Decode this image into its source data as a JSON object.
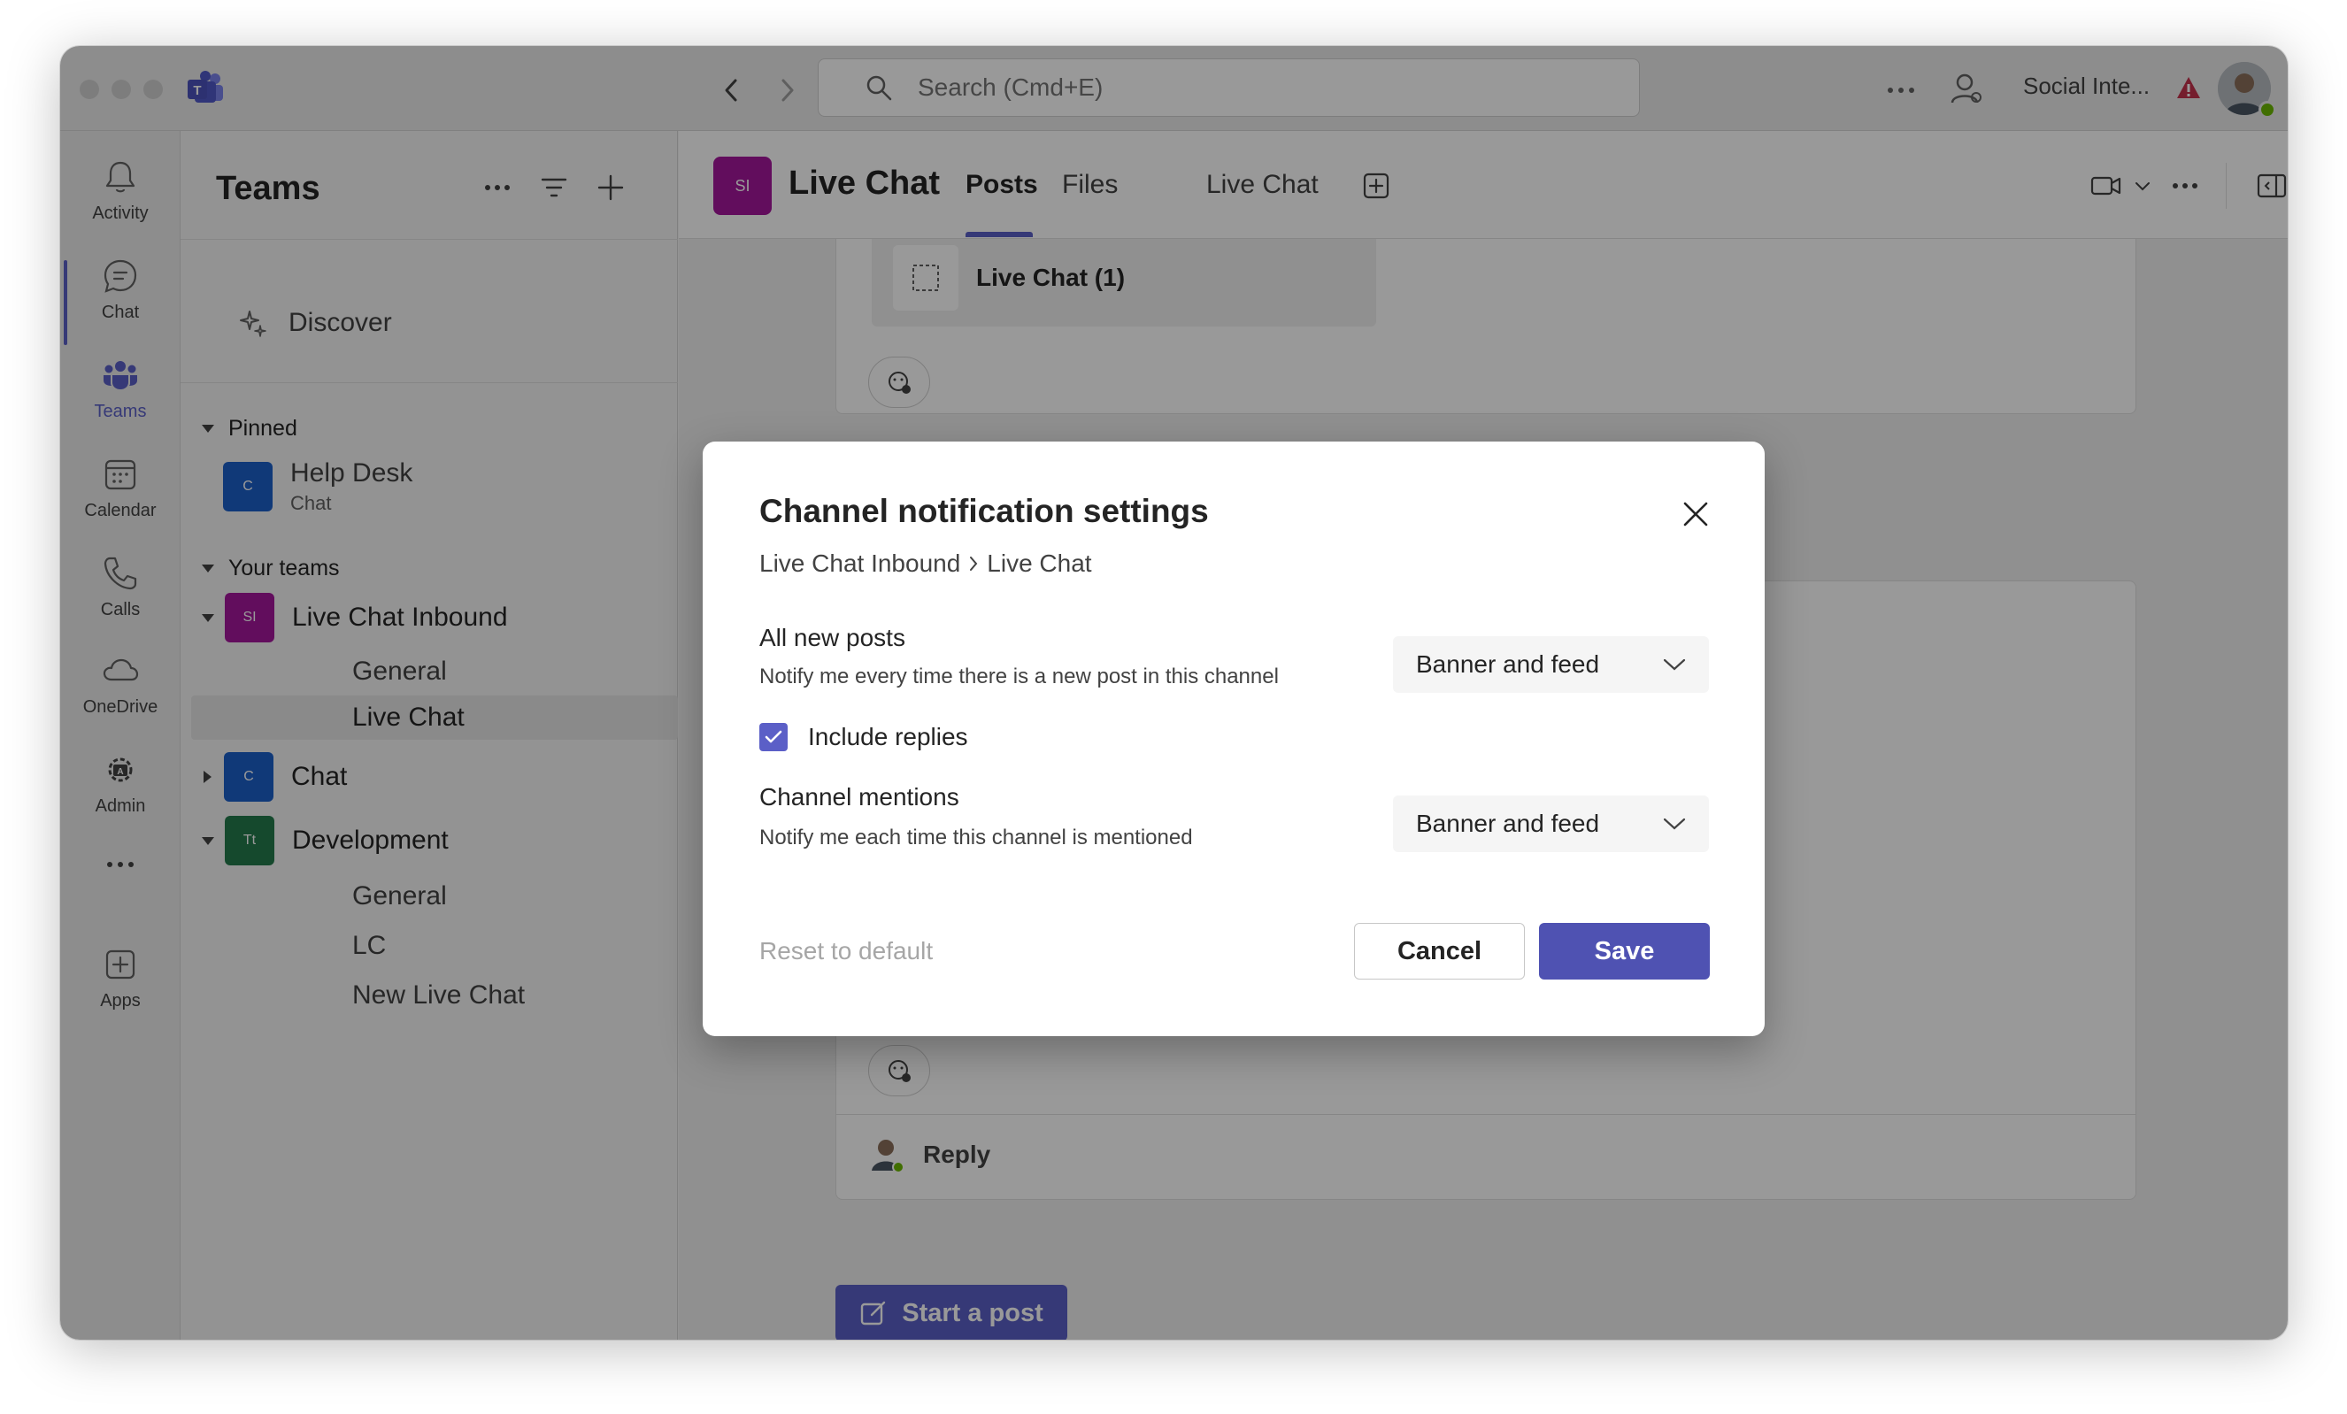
{
  "titlebar": {
    "search_placeholder": "Search (Cmd+E)",
    "org_name": "Social Inte...",
    "icons": [
      "chevron-left-icon",
      "chevron-right-icon",
      "search-icon",
      "more-icon",
      "person-icon",
      "warning-icon"
    ]
  },
  "rail": {
    "items": [
      {
        "label": "Activity",
        "icon": "bell-icon"
      },
      {
        "label": "Chat",
        "icon": "chat-icon"
      },
      {
        "label": "Teams",
        "icon": "teams-icon"
      },
      {
        "label": "Calendar",
        "icon": "calendar-icon"
      },
      {
        "label": "Calls",
        "icon": "phone-icon"
      },
      {
        "label": "OneDrive",
        "icon": "cloud-icon"
      },
      {
        "label": "Admin",
        "icon": "admin-icon"
      },
      {
        "label": "Apps",
        "icon": "add-app-icon"
      }
    ],
    "active": "Teams"
  },
  "leftpane": {
    "title": "Teams",
    "discover": "Discover",
    "pinned_header": "Pinned",
    "pinned": [
      {
        "name": "Help Desk",
        "sub": "Chat",
        "initials": "C"
      }
    ],
    "your_teams_header": "Your teams",
    "teams": [
      {
        "name": "Live Chat Inbound",
        "initials": "SI",
        "color": "#a4169c",
        "channels": [
          "General",
          "Live Chat"
        ]
      },
      {
        "name": "Chat",
        "initials": "C",
        "color": "#1c5fc9",
        "channels": []
      },
      {
        "name": "Development",
        "initials": "Tt",
        "color": "#237b4b",
        "channels": [
          "General",
          "LC",
          "New Live Chat"
        ]
      }
    ]
  },
  "main": {
    "header": {
      "avatar_initials": "SI",
      "title": "Live Chat",
      "tabs": [
        "Posts",
        "Files",
        "Live Chat"
      ],
      "active_tab": "Posts"
    },
    "attachment_label": "Live Chat (1)",
    "reply_label": "Reply",
    "start_post_label": "Start a post"
  },
  "dialog": {
    "title": "Channel notification settings",
    "breadcrumb": [
      "Live Chat Inbound",
      "Live Chat"
    ],
    "all_posts": {
      "title": "All new posts",
      "desc": "Notify me every time there is a new post in this channel",
      "value": "Banner and feed"
    },
    "include_replies": {
      "label": "Include replies",
      "checked": true
    },
    "mentions": {
      "title": "Channel mentions",
      "desc": "Notify me each time this channel is mentioned",
      "value": "Banner and feed"
    },
    "reset_label": "Reset to default",
    "cancel_label": "Cancel",
    "save_label": "Save"
  },
  "colors": {
    "accent": "#5b5fc7",
    "save_button": "#4f52b2",
    "overlay": "rgba(0,0,0,0.40)"
  }
}
